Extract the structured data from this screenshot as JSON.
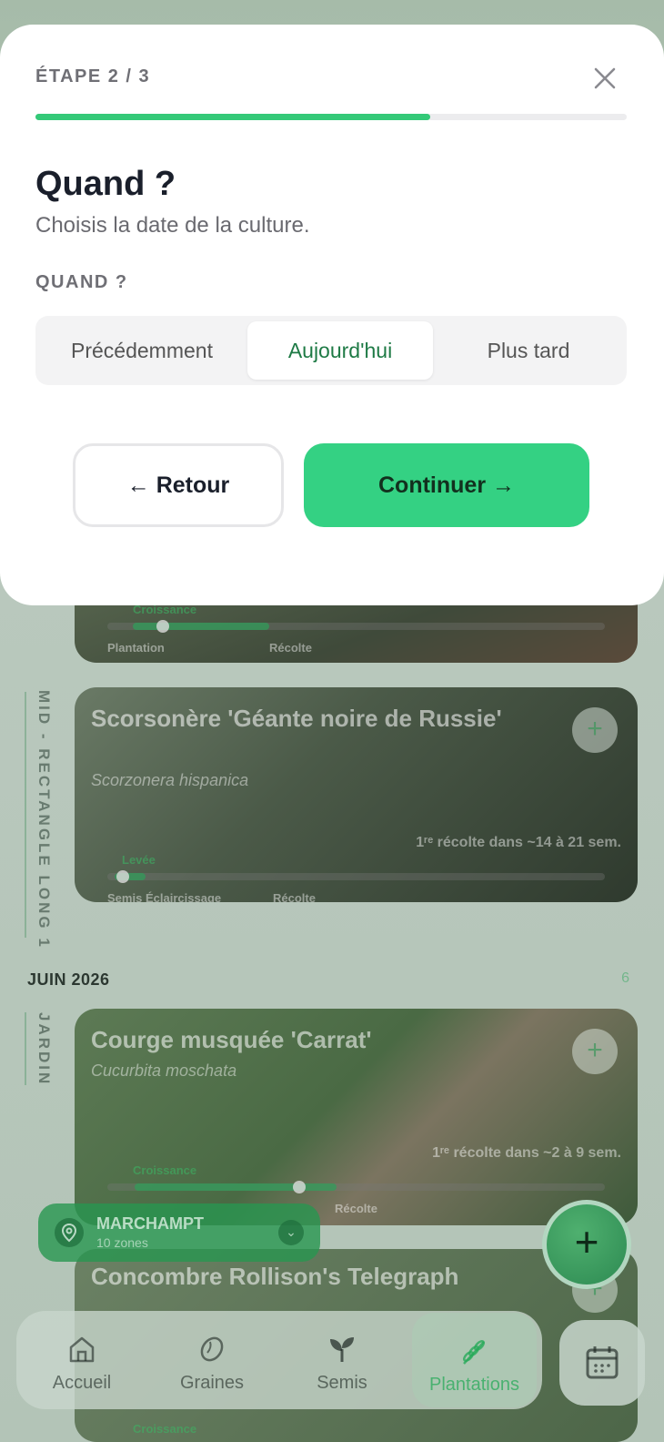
{
  "modal": {
    "step": "ÉTAPE 2 / 3",
    "progress": 0.667,
    "heading": "Quand ?",
    "subheading": "Choisis la date de la culture.",
    "field_label": "QUAND ?",
    "options": [
      "Précédemment",
      "Aujourd'hui",
      "Plus tard"
    ],
    "selected_option": "Aujourd'hui",
    "back_label": "← Retour",
    "next_label": "Continuer →",
    "accent_color": "#34d183"
  },
  "background": {
    "cards": [
      {
        "stage": "Croissance",
        "labels": [
          "Plantation",
          "Récolte"
        ]
      },
      {
        "title": "Scorsonère 'Géante noire de Russie'",
        "latin": "Scorzonera hispanica",
        "eta": "1ʳᵉ récolte dans ~14 à 21 sem.",
        "stage": "Levée",
        "labels": [
          "Semis",
          "Éclaircissage",
          "Récolte"
        ]
      },
      {
        "title": "Courge musquée 'Carrat'",
        "latin": "Cucurbita moschata",
        "eta": "1ʳᵉ récolte dans ~2 à 9 sem.",
        "stage": "Croissance",
        "labels": [
          "Récolte"
        ]
      },
      {
        "title": "Concombre Rollison's Telegraph",
        "stage": "Croissance"
      }
    ],
    "zones": [
      "MID - RECTANGLE LONG 1",
      "JARDIN"
    ],
    "month": "JUIN 2026",
    "month_count": "6",
    "location": {
      "name": "MARCHAMPT",
      "zones": "10 zones"
    },
    "tabs": [
      "Accueil",
      "Graines",
      "Semis",
      "Plantations"
    ],
    "active_tab": "Plantations"
  }
}
